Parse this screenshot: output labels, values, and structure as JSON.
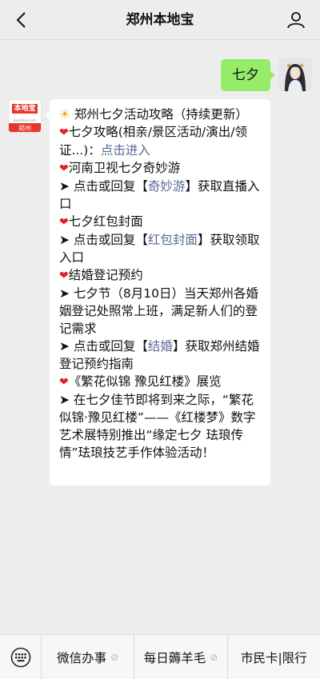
{
  "header": {
    "title": "郑州本地宝"
  },
  "outgoing": {
    "text": "七夕"
  },
  "brand": {
    "logo_text": "本地宝",
    "logo_sub": "Bendibao.com",
    "city": "郑州"
  },
  "message": {
    "l1": "郑州七夕活动攻略（持续更新）",
    "l2a": "七夕攻略(相亲/景区活动/演出/领证...)：",
    "l2b": "点击进入",
    "l3": "河南卫视七夕奇妙游",
    "l4a": "➤ 点击或回复【",
    "l4b": "奇妙游",
    "l4c": "】获取直播入口",
    "l5": "七夕红包封面",
    "l6a": "➤ 点击或回复【",
    "l6b": "红包封面",
    "l6c": "】获取领取入口",
    "l7": "结婚登记预约",
    "l8": "➤ 七夕节（8月10日）当天郑州各婚姻登记处照常上班，满足新人们的登记需求",
    "l9a": "➤ 点击或回复【",
    "l9b": "结婚",
    "l9c": "】获取郑州结婚登记预约指南",
    "l10": "《繁花似锦 豫见红楼》展览",
    "l11": "➤ 在七夕佳节即将到来之际，“繁花似锦·豫见红楼”——《红楼梦》数字艺术展特别推出“缘定七夕 珐琅传情”珐琅技艺手作体验活动！"
  },
  "menu": {
    "item1": "微信办事",
    "item2": "每日薅羊毛",
    "item3": "市民卡|限行"
  },
  "icons": {
    "back": "chevron-left-icon",
    "profile": "person-icon",
    "keyboard": "keyboard-icon",
    "sun": "sun-icon",
    "heart": "heart-icon",
    "menu_link": "link-icon"
  },
  "colors": {
    "bubble_out": "#95ec69",
    "link": "#576b95",
    "heart": "#e0202a",
    "background": "#ededed"
  }
}
